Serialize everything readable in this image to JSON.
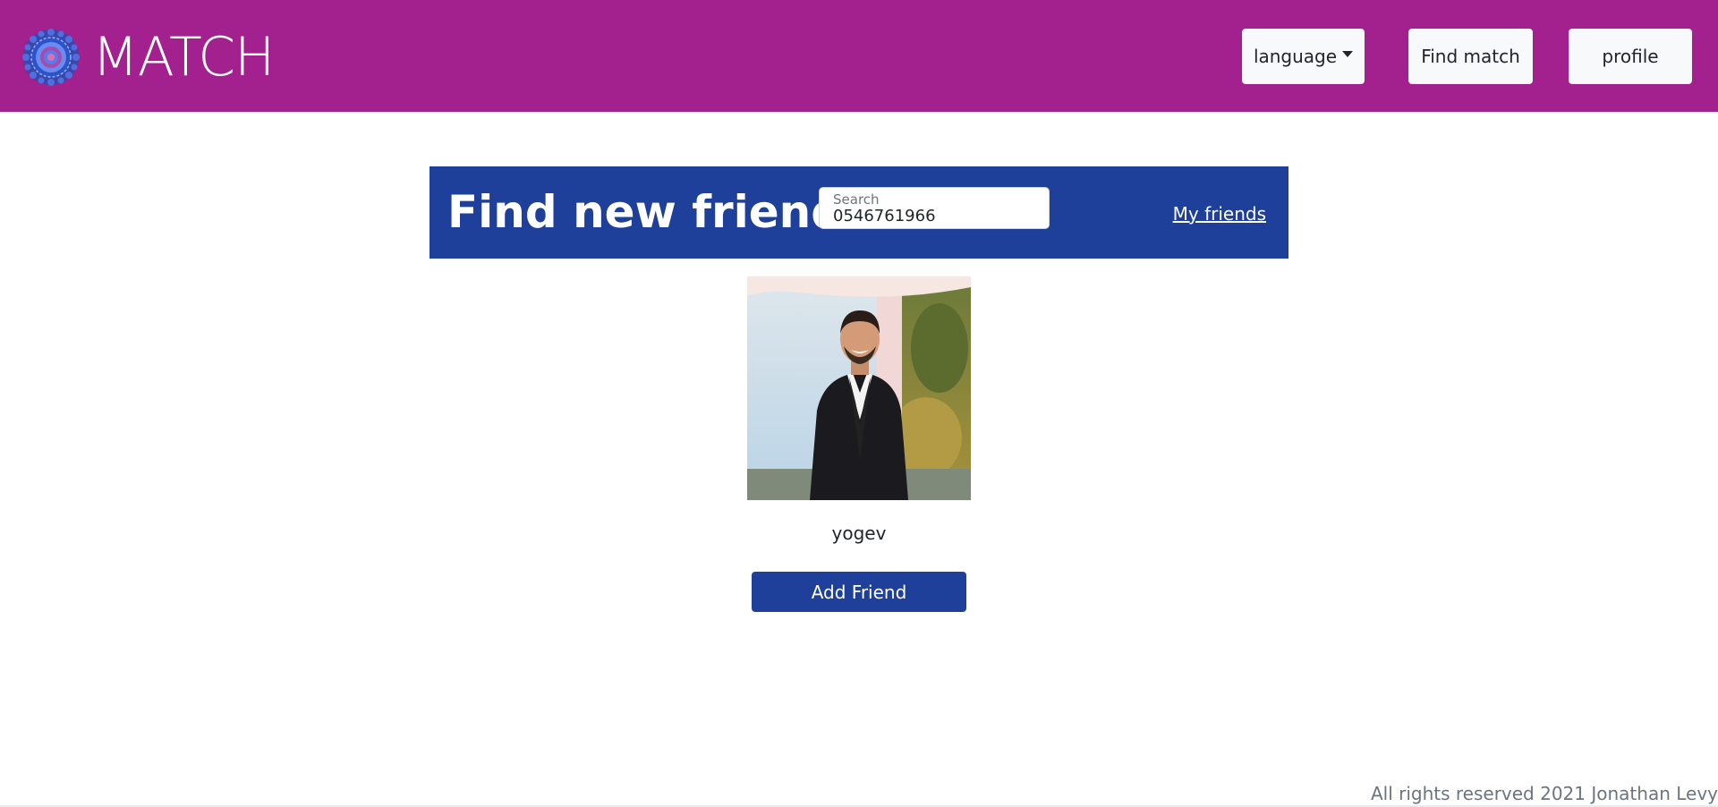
{
  "navbar": {
    "brand_text": "MATCH",
    "logo_icon": "mandala-logo-icon",
    "language_label": "language",
    "find_match_label": "Find match",
    "profile_label": "profile",
    "bg_color": "#a3208f"
  },
  "friends_header": {
    "title": "Find new friends",
    "search_label": "Search",
    "search_value": "0546761966",
    "my_friends_label": "My friends",
    "bg_color": "#1f409a"
  },
  "result": {
    "name": "yogev",
    "add_button_label": "Add Friend",
    "photo_icon": "profile-photo"
  },
  "footer": {
    "text": "All rights reserved 2021 Jonathan Levy"
  }
}
